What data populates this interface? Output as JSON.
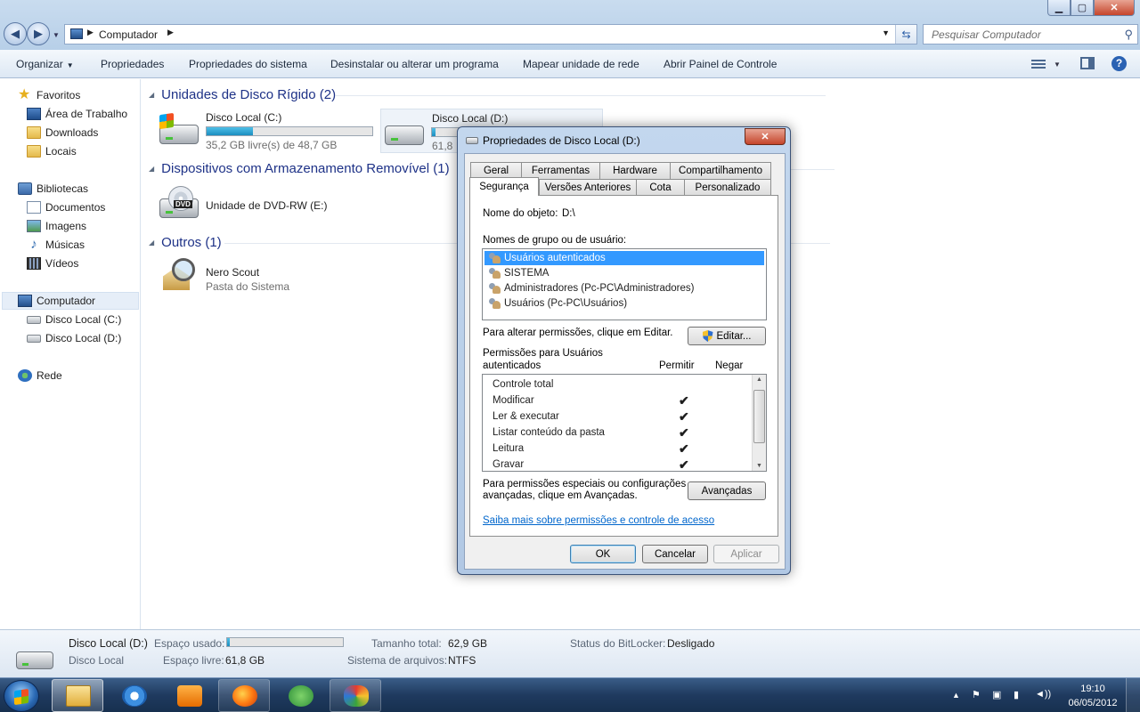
{
  "window": {
    "controls": {
      "min": "▁",
      "max": "▢",
      "close": "✕"
    }
  },
  "address": {
    "crumb": "Computador",
    "search_placeholder": "Pesquisar Computador"
  },
  "commands": {
    "organize": "Organizar",
    "properties": "Propriedades",
    "system_properties": "Propriedades do sistema",
    "uninstall": "Desinstalar ou alterar um programa",
    "map_drive": "Mapear unidade de rede",
    "control_panel": "Abrir Painel de Controle"
  },
  "nav": {
    "favorites": "Favoritos",
    "desktop": "Área de Trabalho",
    "downloads": "Downloads",
    "locais": "Locais",
    "libraries": "Bibliotecas",
    "documents": "Documentos",
    "images": "Imagens",
    "music": "Músicas",
    "videos": "Vídeos",
    "computer": "Computador",
    "disk_c": "Disco Local (C:)",
    "disk_d": "Disco Local (D:)",
    "network": "Rede"
  },
  "content": {
    "group_hdd": "Unidades de Disco Rígido (2)",
    "drive_c": {
      "name": "Disco Local (C:)",
      "free": "35,2 GB livre(s) de 48,7 GB",
      "used_fraction": 0.28
    },
    "drive_d": {
      "name": "Disco Local (D:)",
      "free_partial": "61,8",
      "used_fraction": 0.02
    },
    "group_removable": "Dispositivos com Armazenamento Removível (1)",
    "dvd": {
      "name": "Unidade de DVD-RW (E:)",
      "badge": "DVD"
    },
    "group_other": "Outros (1)",
    "nero": {
      "name": "Nero Scout",
      "sub": "Pasta do Sistema"
    }
  },
  "details": {
    "name": "Disco Local (D:)",
    "type": "Disco Local",
    "used_label": "Espaço usado:",
    "used_fraction": 0.02,
    "free_label": "Espaço livre:",
    "free_value": "61,8 GB",
    "total_label": "Tamanho total:",
    "total_value": "62,9 GB",
    "fs_label": "Sistema de arquivos:",
    "fs_value": "NTFS",
    "bitlocker_label": "Status do BitLocker:",
    "bitlocker_value": "Desligado"
  },
  "dialog": {
    "title": "Propriedades de Disco Local (D:)",
    "tabs_row1": [
      "Geral",
      "Ferramentas",
      "Hardware",
      "Compartilhamento"
    ],
    "tabs_row2": [
      "Segurança",
      "Versões Anteriores",
      "Cota",
      "Personalizado"
    ],
    "object_label": "Nome do objeto:",
    "object_value": "D:\\",
    "groups_label": "Nomes de grupo ou de usuário:",
    "groups": [
      "Usuários autenticados",
      "SISTEMA",
      "Administradores (Pc-PC\\Administradores)",
      "Usuários (Pc-PC\\Usuários)"
    ],
    "edit_hint": "Para alterar permissões, clique em Editar.",
    "edit_button": "Editar...",
    "perms_label_1": "Permissões para Usuários",
    "perms_label_2": "autenticados",
    "allow": "Permitir",
    "deny": "Negar",
    "permissions": [
      {
        "name": "Controle total",
        "allow": ""
      },
      {
        "name": "Modificar",
        "allow": "✔"
      },
      {
        "name": "Ler & executar",
        "allow": "✔"
      },
      {
        "name": "Listar conteúdo da pasta",
        "allow": "✔"
      },
      {
        "name": "Leitura",
        "allow": "✔"
      },
      {
        "name": "Gravar",
        "allow": "✔"
      }
    ],
    "advanced_hint_1": "Para permissões especiais ou configurações",
    "advanced_hint_2": "avançadas, clique em Avançadas.",
    "advanced_button": "Avançadas",
    "learn_link": "Saiba mais sobre permissões e controle de acesso",
    "ok": "OK",
    "cancel": "Cancelar",
    "apply": "Aplicar"
  },
  "taskbar": {
    "time": "19:10",
    "date": "06/05/2012"
  }
}
